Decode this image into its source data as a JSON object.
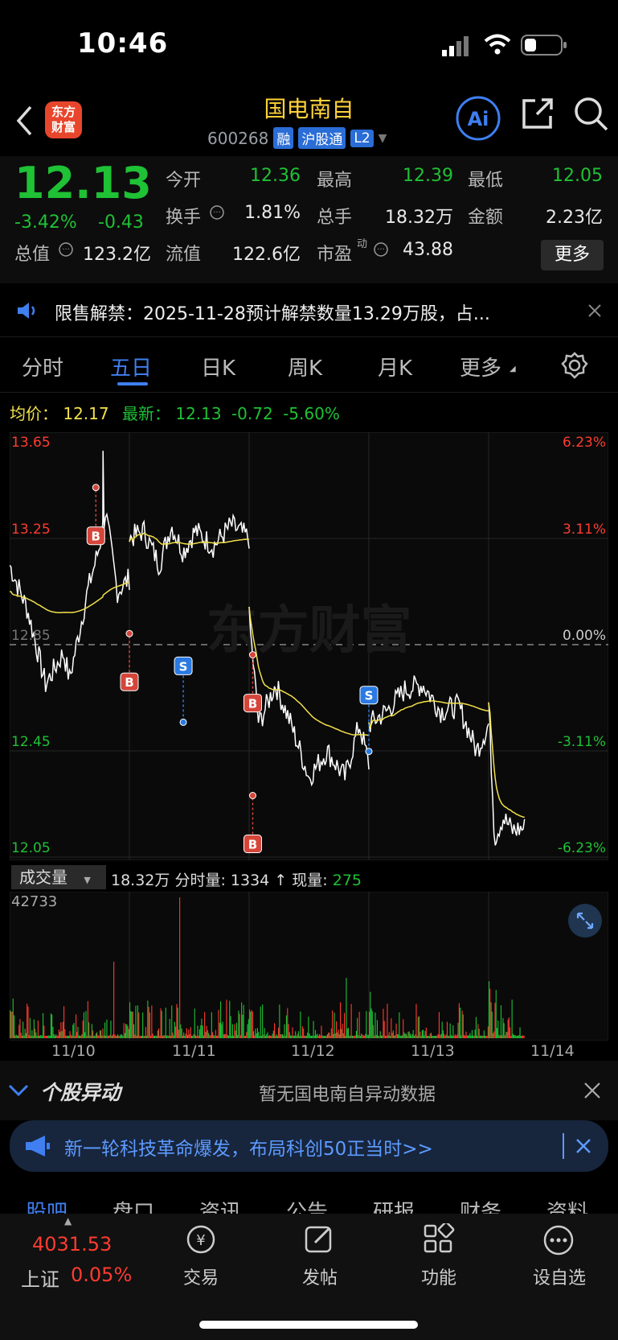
{
  "status": {
    "time": "10:46"
  },
  "header": {
    "logo_text": "东方\n财富",
    "title": "国电南自",
    "code": "600268",
    "tags": [
      "融",
      "沪股通",
      "L2"
    ]
  },
  "quote": {
    "price": "12.13",
    "pct": "-3.42%",
    "change": "-0.43",
    "fields": [
      {
        "label": "今开",
        "value": "12.36",
        "color": "green"
      },
      {
        "label": "最高",
        "value": "12.39",
        "color": "green"
      },
      {
        "label": "最低",
        "value": "12.05",
        "color": "green"
      },
      {
        "label": "换手",
        "value": "1.81%",
        "color": "white"
      },
      {
        "label": "总手",
        "value": "18.32万",
        "color": "white"
      },
      {
        "label": "金额",
        "value": "2.23亿",
        "color": "white"
      },
      {
        "label": "总值",
        "value": "123.2亿",
        "color": "white"
      },
      {
        "label": "流值",
        "value": "122.6亿",
        "color": "white"
      },
      {
        "label": "市盈",
        "value": "43.88",
        "color": "white"
      }
    ],
    "dong": "动",
    "more": "更多"
  },
  "notice": {
    "text": "限售解禁：2025-11-28预计解禁数量13.29万股，占..."
  },
  "tabs": [
    "分时",
    "五日",
    "日K",
    "周K",
    "月K",
    "更多"
  ],
  "active_tab": 1,
  "avg_line": {
    "avg_label": "均价：",
    "avg": "12.17",
    "latest_label": "最新：",
    "latest": "12.13",
    "chg": "-0.72",
    "pct": "-5.60%"
  },
  "chart_data": {
    "type": "line",
    "title": "",
    "y_left_labels": [
      "13.65",
      "13.25",
      "12.85",
      "12.45",
      "12.05"
    ],
    "y_right_labels": [
      "6.23%",
      "3.11%",
      "0.00%",
      "-3.11%",
      "-6.23%"
    ],
    "x_labels": [
      "11/10",
      "11/11",
      "11/12",
      "11/13",
      "11/14"
    ],
    "ylim": [
      12.05,
      13.65
    ],
    "watermark": "东方财富",
    "colors": {
      "price": "#ffffff",
      "avg": "#f2e04b",
      "up": "#ff3b30",
      "down": "#1fc135"
    },
    "markers": [
      {
        "label": "B",
        "day": 0.72,
        "price": 13.26
      },
      {
        "label": "B",
        "day": 1.0,
        "price": 12.71
      },
      {
        "label": "S",
        "day": 1.45,
        "price": 12.77
      },
      {
        "label": "B",
        "day": 2.03,
        "price": 12.63
      },
      {
        "label": "B",
        "day": 2.03,
        "price": 12.1
      },
      {
        "label": "S",
        "day": 3.0,
        "price": 12.66
      }
    ]
  },
  "volume": {
    "label": "成交量",
    "total": "18.32万",
    "fen_label": "分时量:",
    "fen": "1334",
    "arrow": "↑",
    "now_label": "现量:",
    "now": "275",
    "max": "42733"
  },
  "anomaly": {
    "title": "个股异动",
    "text": "暂无国电南自异动数据"
  },
  "promo": {
    "text": "新一轮科技革命爆发，布局科创50正当时>>"
  },
  "subtabs": [
    "股吧",
    "盘口",
    "资讯",
    "公告",
    "研报",
    "财务",
    "资料"
  ],
  "index": {
    "value": "4031.53",
    "name": "上证",
    "pct": "0.05%"
  },
  "nav": [
    "交易",
    "发帖",
    "功能",
    "设自选"
  ]
}
